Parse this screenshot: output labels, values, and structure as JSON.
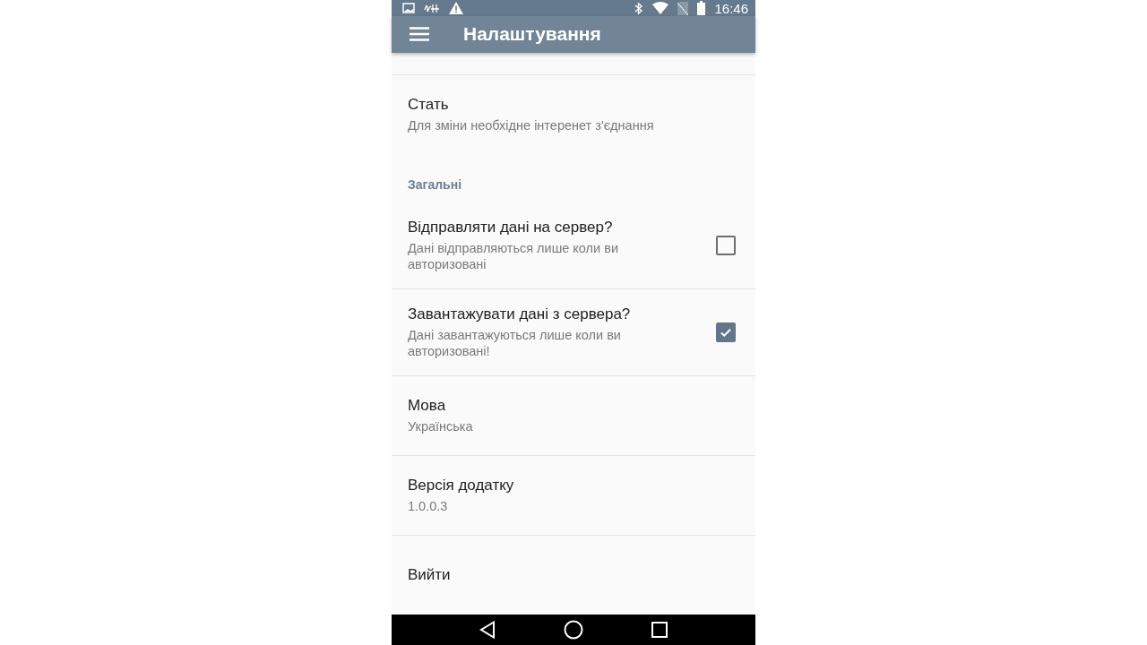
{
  "status_bar": {
    "time": "16:46"
  },
  "app_bar": {
    "title": "Налаштування"
  },
  "items": [
    {
      "kind": "pref",
      "title": "Стать",
      "summary": "Для зміни необхідне інтеренет з'єднання"
    },
    {
      "kind": "category",
      "title": "Загальні"
    },
    {
      "kind": "checkbox",
      "title": "Відправляти дані на сервер?",
      "summary": "Дані відправляються лише коли ви авторизовані",
      "checked": false
    },
    {
      "kind": "checkbox",
      "title": "Завантажувати дані з сервера?",
      "summary": "Дані завантажуються лише коли ви авторизовані!",
      "checked": true
    },
    {
      "kind": "pref",
      "title": "Мова",
      "summary": "Українська"
    },
    {
      "kind": "pref",
      "title": "Версія додатку",
      "summary": "1.0.0.3"
    },
    {
      "kind": "pref",
      "title": "Вийти"
    }
  ]
}
